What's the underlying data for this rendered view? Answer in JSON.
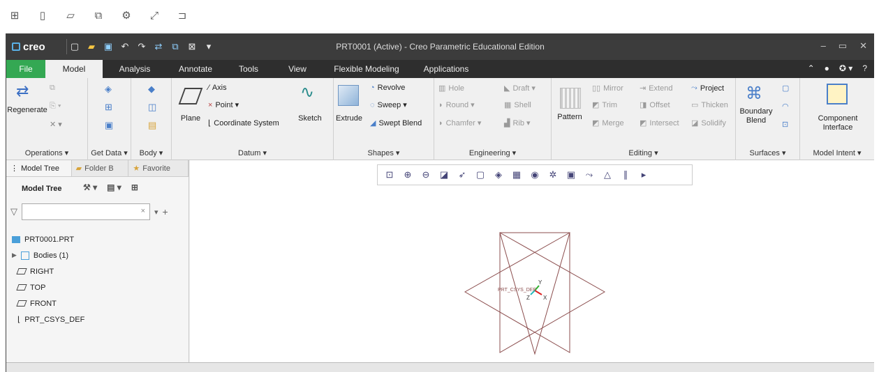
{
  "window": {
    "title": "PRT0001 (Active) - Creo Parametric Educational Edition",
    "logo": "creo"
  },
  "tabs": [
    {
      "label": "File"
    },
    {
      "label": "Model"
    },
    {
      "label": "Analysis"
    },
    {
      "label": "Annotate"
    },
    {
      "label": "Tools"
    },
    {
      "label": "View"
    },
    {
      "label": "Flexible Modeling"
    },
    {
      "label": "Applications"
    }
  ],
  "ribbon": {
    "operations": {
      "label": "Operations ▾",
      "regenerate": "Regenerate"
    },
    "get_data": {
      "label": "Get Data ▾"
    },
    "body": {
      "label": "Body ▾"
    },
    "datum": {
      "label": "Datum ▾",
      "plane": "Plane",
      "axis": "Axis",
      "point": "Point ▾",
      "csys": "Coordinate System",
      "sketch": "Sketch"
    },
    "shapes": {
      "label": "Shapes ▾",
      "extrude": "Extrude",
      "revolve": "Revolve",
      "sweep": "Sweep ▾",
      "swept_blend": "Swept Blend"
    },
    "engineering": {
      "label": "Engineering ▾",
      "hole": "Hole",
      "round": "Round ▾",
      "chamfer": "Chamfer ▾",
      "draft": "Draft ▾",
      "shell": "Shell",
      "rib": "Rib ▾"
    },
    "editing": {
      "label": "Editing ▾",
      "pattern": "Pattern",
      "mirror": "Mirror",
      "trim": "Trim",
      "merge": "Merge",
      "extend": "Extend",
      "offset": "Offset",
      "intersect": "Intersect",
      "project": "Project",
      "thicken": "Thicken",
      "solidify": "Solidify"
    },
    "surfaces": {
      "label": "Surfaces ▾",
      "boundary_blend": "Boundary Blend"
    },
    "model_intent": {
      "label": "Model Intent ▾",
      "component_interface": "Component Interface"
    }
  },
  "panel": {
    "tabs": [
      {
        "label": "Model Tree"
      },
      {
        "label": "Folder B"
      },
      {
        "label": "Favorite"
      }
    ],
    "header": "Model Tree",
    "tree": [
      {
        "label": "PRT0001.PRT"
      },
      {
        "label": "Bodies (1)"
      },
      {
        "label": "RIGHT"
      },
      {
        "label": "TOP"
      },
      {
        "label": "FRONT"
      },
      {
        "label": "PRT_CSYS_DEF"
      }
    ]
  },
  "viewport": {
    "csys_label": "PRT_CSYS_DEF",
    "axis_x": "X",
    "axis_y": "Y",
    "axis_z": "Z",
    "plane_color": "#8b4d4d"
  },
  "colors": {
    "file_tab": "#34a853",
    "titlebar": "#3c3c3c",
    "accent_green": "#2eb02e"
  }
}
